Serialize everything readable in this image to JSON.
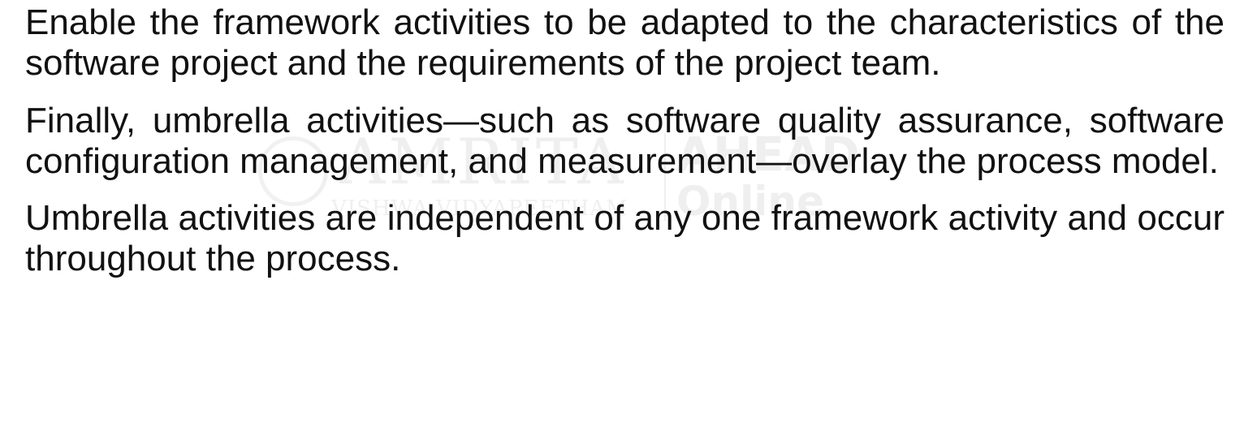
{
  "paragraphs": [
    "Enable the framework activities to be adapted to the characteristics of the software project and the requirements of the project team.",
    "Finally, umbrella activities—such as software quality assurance, software configuration management, and measurement—overlay the process model.",
    "Umbrella activities are independent of any one framework activity and occur throughout the process."
  ],
  "watermark": {
    "name": "AMRITA",
    "subtitle": "VISHWA VIDYAPEETHAM",
    "brand": "AHEAD",
    "brand_sub": "Online"
  }
}
